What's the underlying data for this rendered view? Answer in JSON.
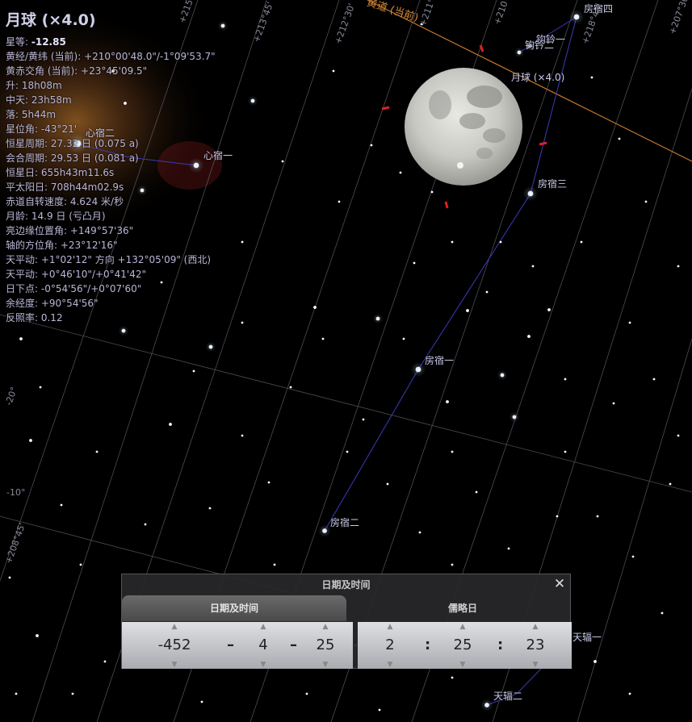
{
  "object": {
    "title": "月球 (×4.0)",
    "rows": [
      {
        "label": "星等: ",
        "value": "-12.85",
        "bold": true
      },
      {
        "label": "黄经/黄纬 (当前): ",
        "value": "+210°00'48.0\"/-1°09'53.7\""
      },
      {
        "label": "黄赤交角 (当前): ",
        "value": "+23°45'09.5\""
      },
      {
        "label": "升: ",
        "value": "18h08m"
      },
      {
        "label": "中天: ",
        "value": "23h58m"
      },
      {
        "label": "落: ",
        "value": "5h44m"
      },
      {
        "label": "星位角: ",
        "value": "-43°21'"
      },
      {
        "label": "恒星周期: ",
        "value": "27.32 日 (0.075 a)"
      },
      {
        "label": "会合周期: ",
        "value": "29.53 日 (0.081 a)"
      },
      {
        "label": "恒星日: ",
        "value": "655h43m11.6s"
      },
      {
        "label": "平太阳日: ",
        "value": "708h44m02.9s"
      },
      {
        "label": "赤道自转速度: ",
        "value": "4.624 米/秒"
      },
      {
        "label": "月龄: ",
        "value": "14.9 日 (亏凸月)"
      },
      {
        "label": "亮边缘位置角: ",
        "value": "+149°57'36\""
      },
      {
        "label": "轴的方位角: ",
        "value": "+23°12'16\""
      },
      {
        "label": "天平动: ",
        "value": "+1°02'12\" 方向 +132°05'09\" (西北)"
      },
      {
        "label": "天平动: ",
        "value": "+0°46'10\"/+0°41'42\""
      },
      {
        "label": "日下点: ",
        "value": "-0°54'56\"/+0°07'60\""
      },
      {
        "label": "余经度: ",
        "value": "+90°54'56\""
      },
      {
        "label": "反照率: ",
        "value": "0.12"
      }
    ]
  },
  "sky_labels": {
    "fang4": "房宿四",
    "gouqian1": "钩钤一",
    "gouqian2": "钩钤二",
    "moon": "月球 (×4.0)",
    "fang3": "房宿三",
    "fang1": "房宿一",
    "fang2": "房宿二",
    "xin1": "心宿一",
    "xin2": "心宿二",
    "tianfu1": "天辐一",
    "tianfu2": "天辐二",
    "ecliptic": "黄道 (当前)"
  },
  "grid_labels": [
    "+215°",
    "+213°45'",
    "+212°30'",
    "+211°15'",
    "+210°",
    "+208°45'",
    "+207°30'",
    "-10°",
    "-20°",
    "+218°45'"
  ],
  "dialog": {
    "title": "日期及时间",
    "close_icon": "close-icon",
    "tabs": {
      "datetime": "日期及时间",
      "julian": "儒略日"
    },
    "date": {
      "year": "-452",
      "month": "4",
      "day": "25",
      "sep": "–"
    },
    "time": {
      "hour": "2",
      "minute": "25",
      "second": "23",
      "sep": ":"
    },
    "spinner_icons": {
      "up": "▲",
      "down": "▼"
    }
  },
  "colors": {
    "background": "#000000",
    "constellation_line": "#3b3bb8",
    "ecliptic": "#c87a30",
    "grid": "#6e6e78",
    "info_text": "#b9b7d6"
  }
}
